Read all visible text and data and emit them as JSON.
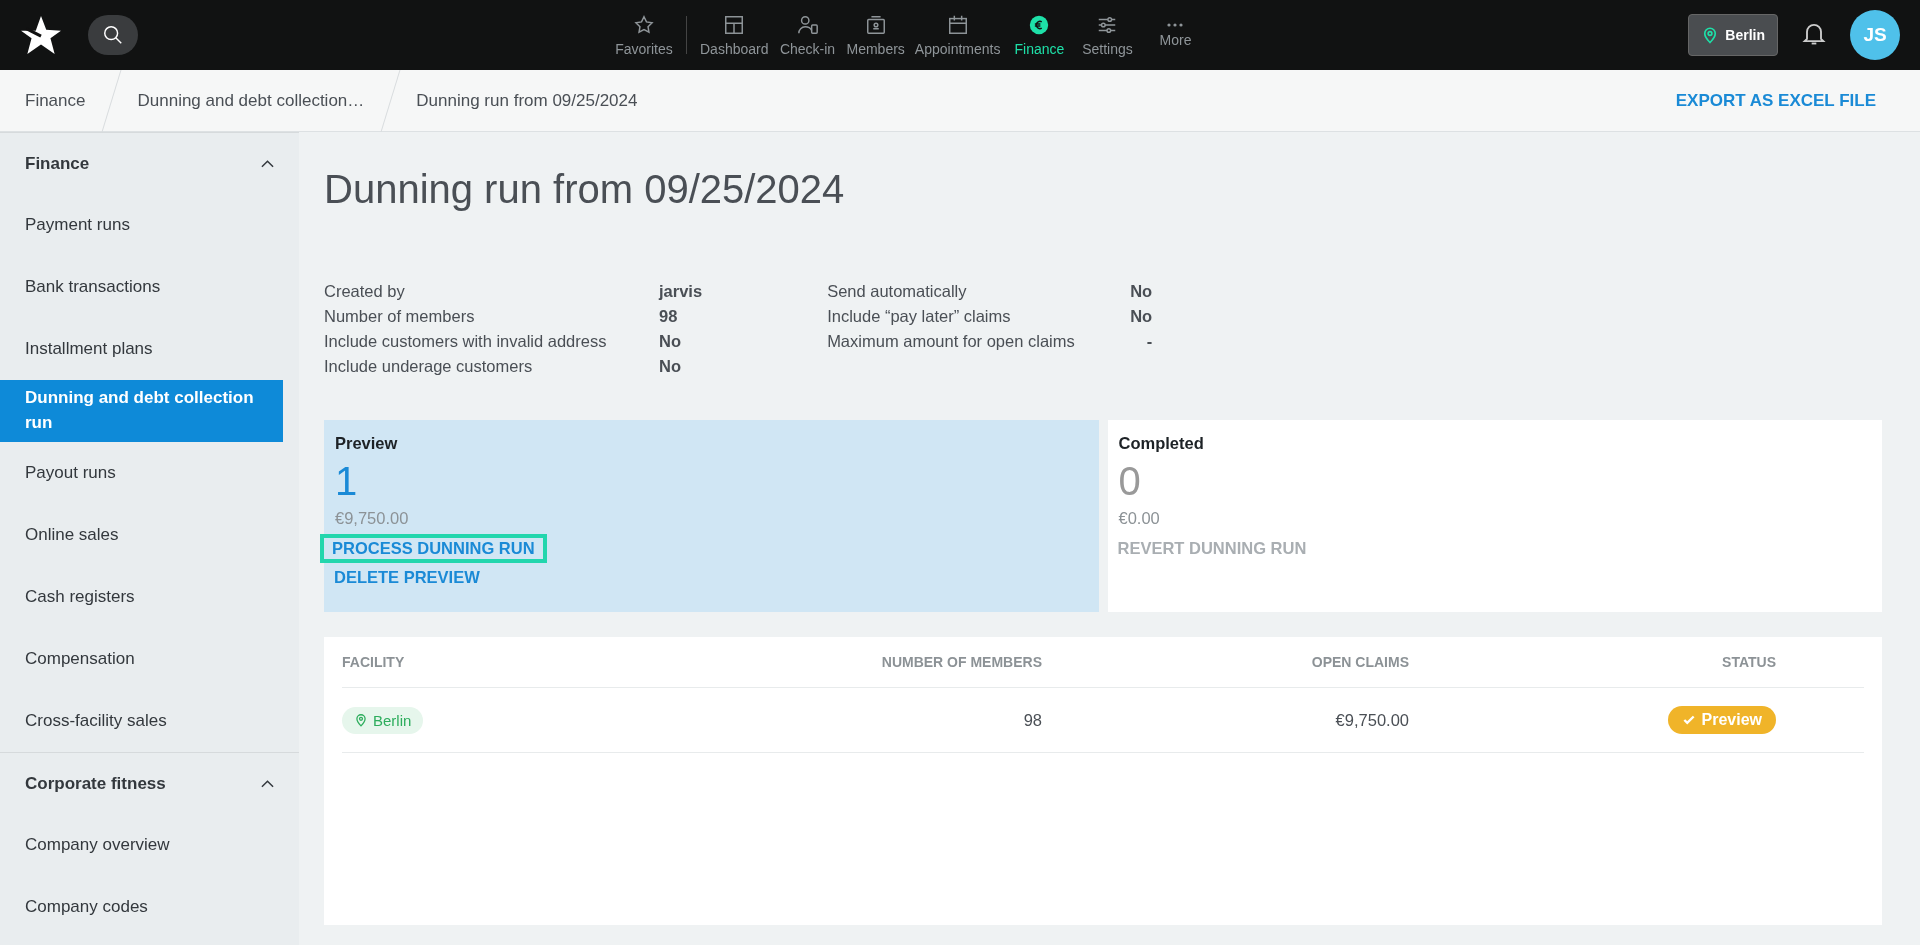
{
  "topbar": {
    "nav": [
      {
        "label": "Favorites",
        "selected": false
      },
      {
        "label": "Dashboard",
        "selected": false
      },
      {
        "label": "Check-in",
        "selected": false
      },
      {
        "label": "Members",
        "selected": false
      },
      {
        "label": "Appointments",
        "selected": false
      },
      {
        "label": "Finance",
        "selected": true
      },
      {
        "label": "Settings",
        "selected": false
      },
      {
        "label": "More",
        "selected": false
      }
    ],
    "location": "Berlin",
    "avatar": "JS"
  },
  "breadcrumb": {
    "items": [
      "Finance",
      "Dunning and debt collection…",
      "Dunning run from 09/25/2024"
    ],
    "action": "EXPORT AS EXCEL FILE"
  },
  "sidebar": {
    "sections": [
      {
        "label": "Finance",
        "expanded": true,
        "items": [
          {
            "label": "Payment runs",
            "selected": false
          },
          {
            "label": "Bank transactions",
            "selected": false
          },
          {
            "label": "Installment plans",
            "selected": false
          },
          {
            "label": "Dunning and debt collection run",
            "selected": true
          },
          {
            "label": "Payout runs",
            "selected": false
          },
          {
            "label": "Online sales",
            "selected": false
          },
          {
            "label": "Cash registers",
            "selected": false
          },
          {
            "label": "Compensation",
            "selected": false
          },
          {
            "label": "Cross-facility sales",
            "selected": false
          }
        ]
      },
      {
        "label": "Corporate fitness",
        "expanded": true,
        "items": [
          {
            "label": "Company overview",
            "selected": false
          },
          {
            "label": "Company codes",
            "selected": false
          }
        ]
      }
    ]
  },
  "title": "Dunning run from 09/25/2024",
  "details": [
    [
      {
        "label": "Created by",
        "value": "jarvis"
      },
      {
        "label": "Number of members",
        "value": "98"
      },
      {
        "label": "Include customers with invalid address",
        "value": "No"
      },
      {
        "label": "Include underage customers",
        "value": "No"
      }
    ],
    [
      {
        "label": "Send automatically",
        "value": "No"
      },
      {
        "label": "Include “pay later” claims",
        "value": "No"
      },
      {
        "label": "Maximum amount for open claims",
        "value": "-"
      }
    ]
  ],
  "cards": [
    {
      "title": "Preview",
      "count": "1",
      "amount": "€9,750.00",
      "selected": true,
      "actions": [
        {
          "label": "PROCESS DUNNING RUN",
          "disabled": false,
          "focused": true
        },
        {
          "label": "DELETE PREVIEW",
          "disabled": false,
          "focused": false
        }
      ]
    },
    {
      "title": "Completed",
      "count": "0",
      "amount": "€0.00",
      "selected": false,
      "actions": [
        {
          "label": "REVERT DUNNING RUN",
          "disabled": true,
          "focused": false
        }
      ]
    }
  ],
  "table": {
    "columns": [
      "FACILITY",
      "NUMBER OF MEMBERS",
      "OPEN CLAIMS",
      "STATUS"
    ],
    "rows": [
      {
        "facility": "Berlin",
        "members": "98",
        "open_claims": "€9,750.00",
        "status": "Preview",
        "color": "#f0b429"
      }
    ]
  }
}
